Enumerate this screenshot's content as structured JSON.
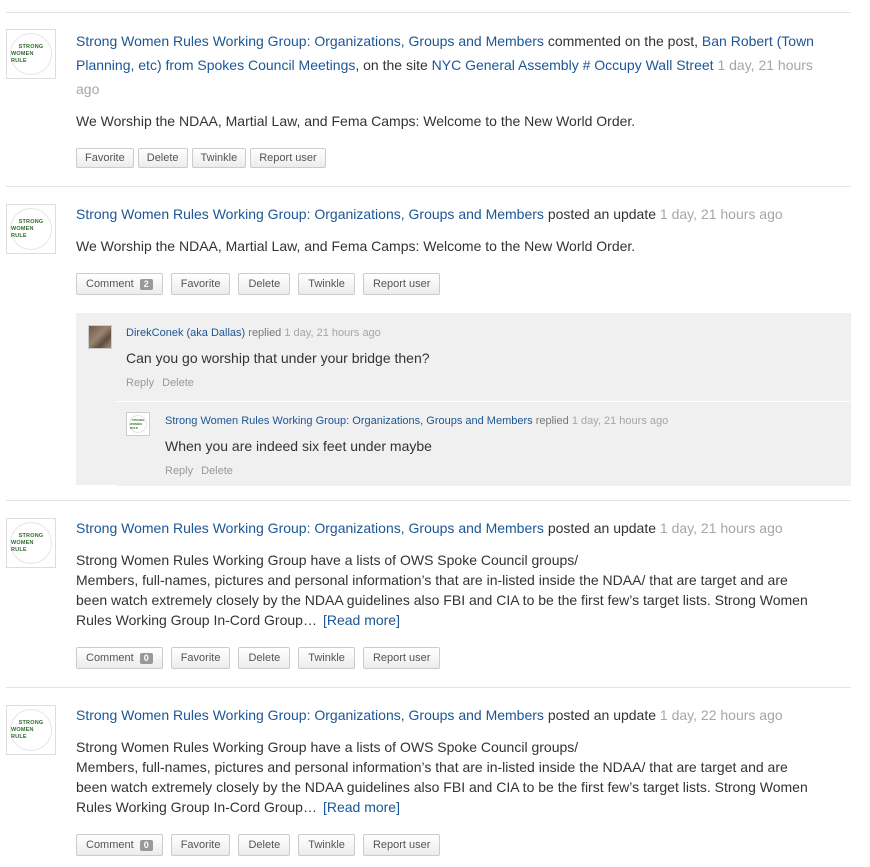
{
  "avatar_text": [
    "STRONG",
    "WOMEN RULE"
  ],
  "group_name": "Strong Women Rules Working Group: Organizations, Groups and Members",
  "buttons": {
    "comment": "Comment",
    "favorite": "Favorite",
    "delete": "Delete",
    "twinkle": "Twinkle",
    "report": "Report user"
  },
  "items": [
    {
      "action_pre": "commented on the post,",
      "post_link": "Ban Robert (Town Planning, etc) from Spokes Council Meetings",
      "site_pre": ", on the site",
      "site_link": "NYC General Assembly # Occupy Wall Street",
      "time": "1 day, 21 hours ago",
      "content": "We Worship the NDAA, Martial Law, and Fema Camps: Welcome to the New World Order."
    },
    {
      "action": "posted an update",
      "time": "1 day, 21 hours ago",
      "content": "We Worship the NDAA, Martial Law, and Fema Camps: Welcome to the New World Order.",
      "comment_count": "2",
      "replies": [
        {
          "author": "DirekConek (aka Dallas)",
          "verb": "replied",
          "time": "1 day, 21 hours ago",
          "text": "Can you go worship that under your bridge then?",
          "reply": "Reply",
          "delete": "Delete"
        },
        {
          "author": "Strong Women Rules Working Group: Organizations, Groups and Members",
          "verb": "replied",
          "time": "1 day, 21 hours ago",
          "text": "When you are indeed six feet under maybe",
          "reply": "Reply",
          "delete": "Delete"
        }
      ]
    },
    {
      "action": "posted an update",
      "time": "1 day, 21 hours ago",
      "content_lines": [
        "Strong Women Rules Working Group have a lists of OWS Spoke Council groups/",
        "Members, full-names, pictures and personal information’s that are in-listed inside the NDAA/ that are target and are",
        "been watch extremely closely by the NDAA guidelines also FBI and CIA to be the first few’s target lists. Strong Women",
        "Rules Working Group In-Cord Group…"
      ],
      "read_more": "[Read more]",
      "comment_count": "0"
    },
    {
      "action": "posted an update",
      "time": "1 day, 22 hours ago",
      "content_lines": [
        "Strong Women Rules Working Group have a lists of OWS Spoke Council groups/",
        "Members, full-names, pictures and personal information’s that are in-listed inside the NDAA/ that are target and are",
        "been watch extremely closely by the NDAA guidelines also FBI and CIA to be the first few’s target lists. Strong Women",
        "Rules Working Group In-Cord Group…"
      ],
      "read_more": "[Read more]",
      "comment_count": "0"
    }
  ]
}
